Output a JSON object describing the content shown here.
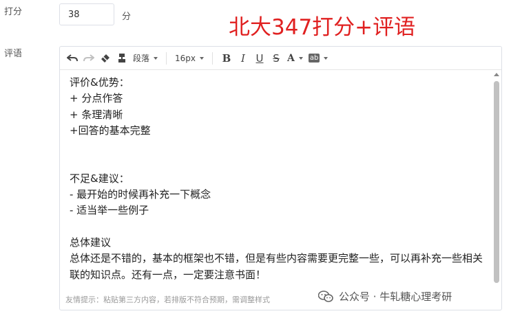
{
  "score": {
    "label": "打分",
    "value": "38",
    "unit": "分"
  },
  "comment": {
    "label": "评语"
  },
  "overlay_title": "北大347打分+评语",
  "toolbar": {
    "undo_icon": "undo-icon",
    "redo_icon": "redo-icon",
    "clear_format_icon": "eraser-icon",
    "format_painter_icon": "format-painter-icon",
    "paragraph_select": "段落",
    "font_size_select": "16px",
    "bold": "B",
    "italic": "I",
    "underline": "U",
    "strike": "S",
    "font_color": "A",
    "bg_color": "ab"
  },
  "content": {
    "lines": [
      "评价&优势：",
      "+ 分点作答",
      "+ 条理清晰",
      "+回答的基本完整",
      "",
      "",
      "不足&建议：",
      "- 最开始的时候再补充一下概念",
      "- 适当举一些例子",
      "",
      "总体建议",
      "总体还是不错的，基本的框架也不错，但是有些内容需要更完整一些，可以再补充一些相关联的知识点。还有一点，一定要注意书面！"
    ]
  },
  "hint": "友情提示：粘贴第三方内容，若排版不符合预期，需调整样式",
  "watermark": "公众号 · 牛轧糖心理考研",
  "colors": {
    "overlay_title": "#e02020",
    "border": "#dcdfe6",
    "hint": "#999999"
  }
}
